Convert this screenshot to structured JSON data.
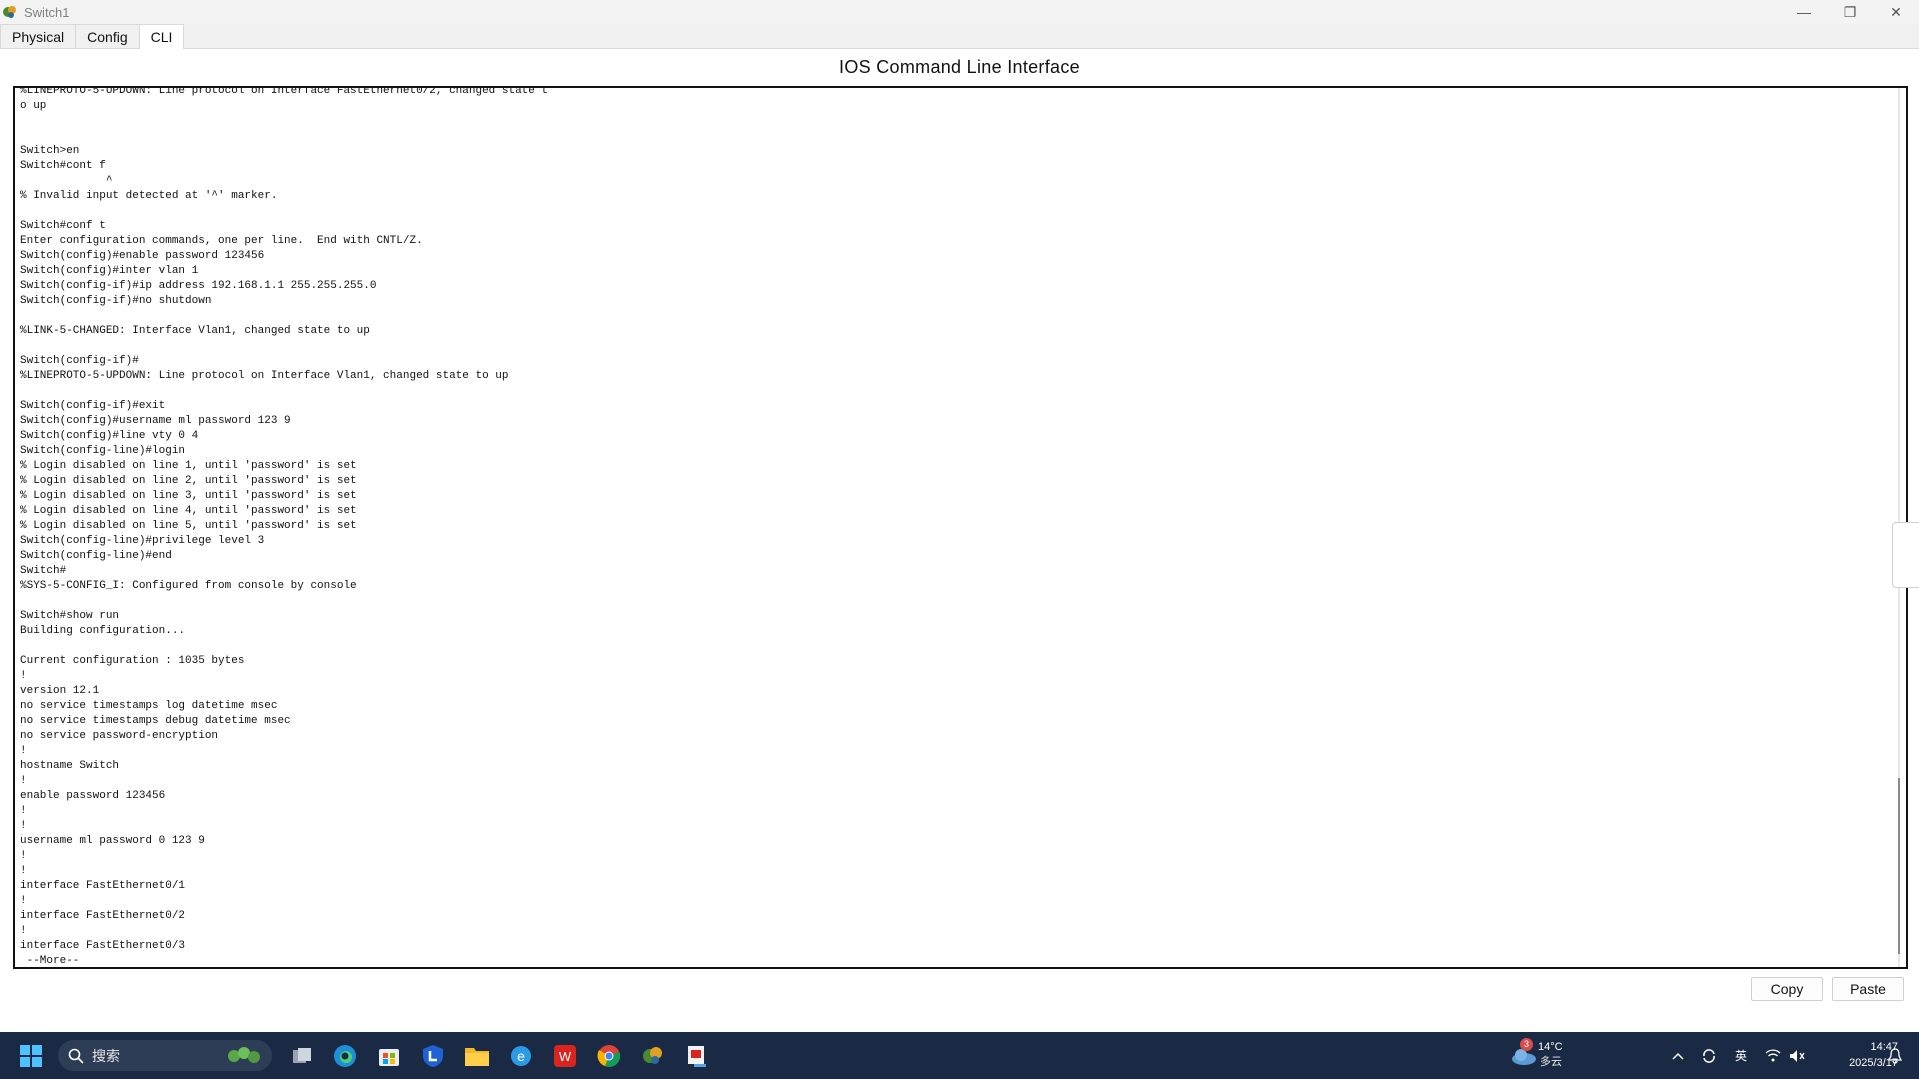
{
  "window": {
    "title": "Switch1",
    "controls": {
      "minimize": "—",
      "restore": "❐",
      "close": "✕"
    }
  },
  "tabs": [
    {
      "label": "Physical",
      "active": false
    },
    {
      "label": "Config",
      "active": false
    },
    {
      "label": "CLI",
      "active": true
    }
  ],
  "panel": {
    "title": "IOS Command Line Interface"
  },
  "terminal": {
    "text": "%LINEPROTO-5-UPDOWN: Line protocol on Interface FastEthernet0/2, changed state t\no up\n\n\nSwitch>en\nSwitch#cont f\n             ^\n% Invalid input detected at '^' marker.\n\nSwitch#conf t\nEnter configuration commands, one per line.  End with CNTL/Z.\nSwitch(config)#enable password 123456\nSwitch(config)#inter vlan 1\nSwitch(config-if)#ip address 192.168.1.1 255.255.255.0\nSwitch(config-if)#no shutdown\n\n%LINK-5-CHANGED: Interface Vlan1, changed state to up\n\nSwitch(config-if)#\n%LINEPROTO-5-UPDOWN: Line protocol on Interface Vlan1, changed state to up\n\nSwitch(config-if)#exit\nSwitch(config)#username ml password 123 9\nSwitch(config)#line vty 0 4\nSwitch(config-line)#login\n% Login disabled on line 1, until 'password' is set\n% Login disabled on line 2, until 'password' is set\n% Login disabled on line 3, until 'password' is set\n% Login disabled on line 4, until 'password' is set\n% Login disabled on line 5, until 'password' is set\nSwitch(config-line)#privilege level 3\nSwitch(config-line)#end\nSwitch#\n%SYS-5-CONFIG_I: Configured from console by console\n\nSwitch#show run\nBuilding configuration...\n\nCurrent configuration : 1035 bytes\n!\nversion 12.1\nno service timestamps log datetime msec\nno service timestamps debug datetime msec\nno service password-encryption\n!\nhostname Switch\n!\nenable password 123456\n!\n!\nusername ml password 0 123 9\n!\n!\ninterface FastEthernet0/1\n!\ninterface FastEthernet0/2\n!\ninterface FastEthernet0/3\n --More--"
  },
  "buttons": {
    "copy": "Copy",
    "paste": "Paste"
  },
  "taskbar": {
    "search_label": "搜索",
    "weather": {
      "temp": "14°C",
      "desc": "多云",
      "badge": "3"
    },
    "ime": "英",
    "clock": {
      "time": "14:47",
      "date": "2025/3/17"
    }
  }
}
